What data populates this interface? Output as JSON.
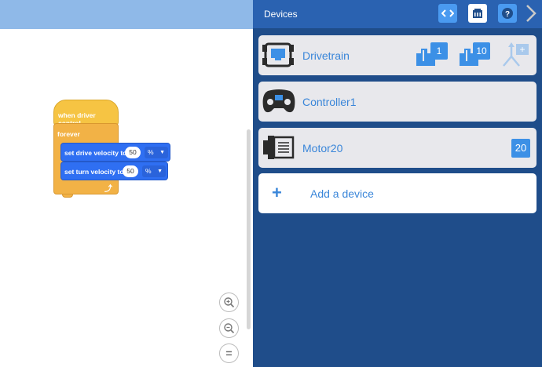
{
  "workspace": {
    "blocks": {
      "hat_label": "when driver control",
      "forever_label": "forever",
      "drive_velocity": {
        "label": "set drive velocity to",
        "value": "50",
        "unit": "%"
      },
      "turn_velocity": {
        "label": "set turn velocity to",
        "value": "50",
        "unit": "%"
      }
    },
    "zoom": {
      "in_icon": "zoom-in-icon",
      "out_icon": "zoom-out-icon",
      "reset_icon": "zoom-reset-icon"
    }
  },
  "devices_panel": {
    "title": "Devices",
    "header_icons": [
      "code-view-icon",
      "brain-icon",
      "help-icon",
      "chevron-right-icon"
    ],
    "devices": [
      {
        "name": "Drivetrain",
        "icon": "drivetrain-icon",
        "ports": [
          "1",
          "10"
        ]
      },
      {
        "name": "Controller1",
        "icon": "controller-icon"
      },
      {
        "name": "Motor20",
        "icon": "motor-icon",
        "port": "20"
      }
    ],
    "add_device_label": "Add a device"
  },
  "colors": {
    "panel_bg": "#1f4d8a",
    "panel_header": "#2a62b1",
    "event_block": "#f6c443",
    "control_block": "#f2b246",
    "motion_block": "#2f6ff2",
    "accent": "#3a86d9"
  }
}
